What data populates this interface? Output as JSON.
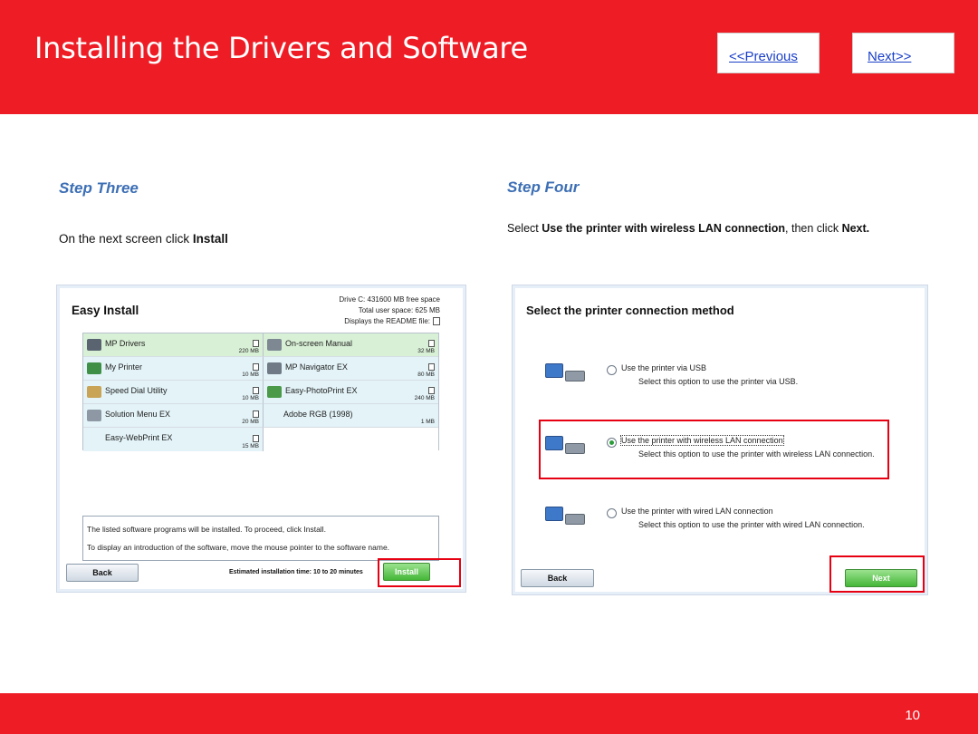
{
  "header": {
    "title": "Installing  the Drivers and Software",
    "prev_label": "<<Previous",
    "next_label": "Next>>",
    "background_color": "#ee1c25"
  },
  "step_three": {
    "heading": "Step Three",
    "text_prefix": "On the next screen click ",
    "text_bold": "Install"
  },
  "step_four": {
    "heading": "Step Four",
    "text_prefix": "Select ",
    "text_bold": "Use the printer with wireless LAN connection",
    "text_middle": ", then click ",
    "text_bold2": "Next."
  },
  "easy_install": {
    "title": "Easy Install",
    "drive_info": "Drive C: 431600 MB free space",
    "total_space": "Total user space: 625 MB",
    "readme": "Displays the README file:",
    "software": [
      {
        "name": "MP Drivers",
        "size": "220 MB",
        "icon": "printer-driver-icon"
      },
      {
        "name": "On-screen Manual",
        "size": "32 MB",
        "icon": "manual-icon"
      },
      {
        "name": "My Printer",
        "size": "10 MB",
        "icon": "my-printer-icon"
      },
      {
        "name": "MP Navigator EX",
        "size": "80 MB",
        "icon": "navigator-icon"
      },
      {
        "name": "Speed Dial Utility",
        "size": "10 MB",
        "icon": "speed-dial-icon"
      },
      {
        "name": "Easy-PhotoPrint EX",
        "size": "240 MB",
        "icon": "photoprint-icon"
      },
      {
        "name": "Solution Menu EX",
        "size": "20 MB",
        "icon": "solution-menu-icon"
      },
      {
        "name": "Adobe RGB (1998)",
        "size": "1 MB",
        "icon": ""
      },
      {
        "name": "Easy-WebPrint EX",
        "size": "15 MB",
        "icon": ""
      }
    ],
    "description_line1": "The listed software programs will be installed. To proceed, click Install.",
    "description_line2": "To display an introduction of the software, move the mouse pointer to the software name.",
    "back_label": "Back",
    "estimate": "Estimated installation time: 10 to 20 minutes",
    "install_label": "Install"
  },
  "connection": {
    "title": "Select the printer connection method",
    "options": [
      {
        "label": "Use the printer via USB",
        "sub": "Select this option to use the printer via USB.",
        "selected": false
      },
      {
        "label": "Use the printer with wireless LAN connection",
        "sub": "Select this option to use the printer with wireless LAN connection.",
        "selected": true
      },
      {
        "label": "Use the printer with wired LAN connection",
        "sub": "Select this option to use the printer with wired LAN connection.",
        "selected": false
      }
    ],
    "back_label": "Back",
    "next_label": "Next"
  },
  "footer": {
    "page_number": "10"
  }
}
